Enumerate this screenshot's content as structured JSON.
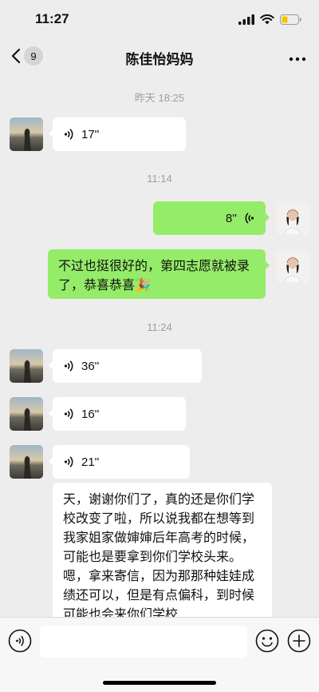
{
  "status_bar": {
    "time": "11:27"
  },
  "header": {
    "unread_count": "9",
    "title": "陈佳怡妈妈"
  },
  "timestamps": [
    "昨天 18:25",
    "11:14",
    "11:24"
  ],
  "messages": {
    "m1": {
      "duration": "17''"
    },
    "m2": {
      "duration": "8''"
    },
    "m3": {
      "text": "不过也挺很好的，第四志愿就被录了，恭喜恭喜🎉"
    },
    "m4": {
      "duration": "36''"
    },
    "m5": {
      "duration": "16''"
    },
    "m6": {
      "duration": "21''"
    },
    "m7": {
      "text": "天，谢谢你们了，真的还是你们学校改变了啦，所以说我都在想等到我家姐家做婶婶后年高考的时候，可能也是要拿到你们学校头来。嗯，拿来寄信，因为那那种娃娃成绩还可以，但是有点偏科，到时候可能也会来你们学校"
    }
  },
  "input": {
    "placeholder": ""
  },
  "colors": {
    "sent_bubble": "#95ec69",
    "received_bubble": "#ffffff",
    "background": "#ededed"
  }
}
